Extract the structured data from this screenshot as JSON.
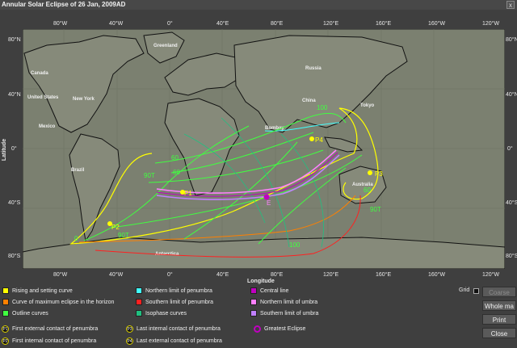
{
  "window": {
    "title": "Annular Solar Eclipse of 26 Jan, 2009AD",
    "close_glyph": "x"
  },
  "axes": {
    "ylabel": "Latitude",
    "xlabel": "Longitude",
    "top_ticks": [
      "80°W",
      "40°W",
      "0°",
      "40°E",
      "80°E",
      "120°E",
      "160°E",
      "160°W",
      "120°W"
    ],
    "bottom_ticks": [
      "80°W",
      "40°W",
      "0°",
      "40°E",
      "80°E",
      "120°E",
      "160°E",
      "160°W",
      "120°W"
    ],
    "lat_ticks": [
      "80°N",
      "40°N",
      "0°",
      "40°S",
      "80°S"
    ]
  },
  "map": {
    "ocean_color": "#7b8070",
    "continents": [
      "Canada",
      "United States",
      "New York",
      "Mexico",
      "Brazil",
      "Russia",
      "China",
      "Tokyo",
      "Bombay",
      "Australia",
      "Antarctica",
      "Greenland"
    ],
    "marks": {
      "p1": "P1",
      "p2": "P2",
      "p3": "P3",
      "p4": "P4",
      "ge": "E",
      "labels": [
        "100",
        "60",
        "60",
        "90T",
        "60",
        "90T",
        "90T",
        "100",
        "0"
      ]
    }
  },
  "legend": {
    "items": [
      {
        "label": "Rising and setting curve",
        "color": "#ffff00"
      },
      {
        "label": "Curve of maximum eclipse in the horizon",
        "color": "#ff8000"
      },
      {
        "label": "Outline curves",
        "color": "#40ff40"
      },
      {
        "label": "Northern limit of penumbra",
        "color": "#40ffff"
      },
      {
        "label": "Southern limit of penumbra",
        "color": "#ff2020"
      },
      {
        "label": "Isophase curves",
        "color": "#20c080"
      },
      {
        "label": "Central line",
        "color": "#c000c0"
      },
      {
        "label": "Northern limit of umbra",
        "color": "#ff80ff"
      },
      {
        "label": "Southern limit of umbra",
        "color": "#c080ff"
      }
    ],
    "contacts": [
      {
        "badge": "P1",
        "label": "First external contact of penumbra"
      },
      {
        "badge": "P2",
        "label": "First internal contact of penumbra"
      },
      {
        "badge": "P3",
        "label": "Last internal contact of penumbra"
      },
      {
        "badge": "P4",
        "label": "Last external contact of penumbra"
      }
    ],
    "greatest": "Greatest Eclipse"
  },
  "controls": {
    "grid_label": "Grid",
    "coarse": "Coarse",
    "whole_map": "Whole ma",
    "print": "Print",
    "close": "Close"
  }
}
